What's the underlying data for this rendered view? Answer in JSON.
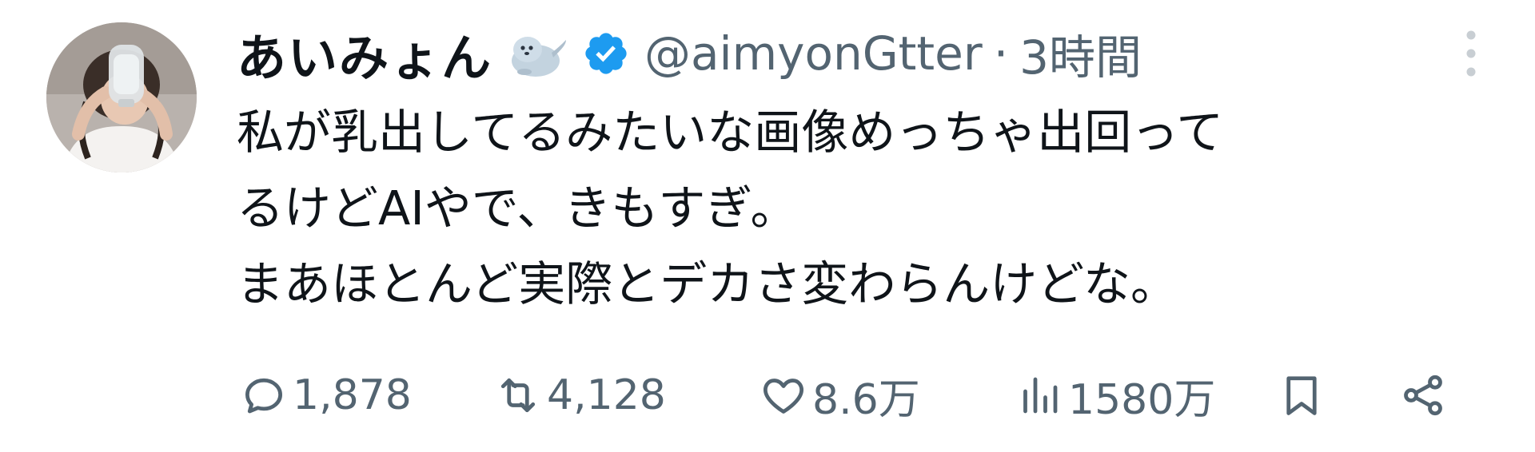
{
  "author": {
    "display_name": "あいみょん",
    "name_emoji": "seal-icon",
    "verified": "verified-badge-icon",
    "handle": "@aimyonGtter",
    "separator": "·",
    "time": "3時間"
  },
  "tweet": {
    "text": "私が乳出してるみたいな画像めっちゃ出回って\nるけどAIやで、きもすぎ。\nまあほとんど実際とデカさ変わらんけどな。"
  },
  "actions": {
    "replies": "1,878",
    "retweets": "4,128",
    "likes": "8.6万",
    "views": "1580万"
  },
  "colors": {
    "text_primary": "#0f1419",
    "text_secondary": "#536471",
    "verified_blue": "#1d9bf0",
    "background": "#ffffff"
  }
}
